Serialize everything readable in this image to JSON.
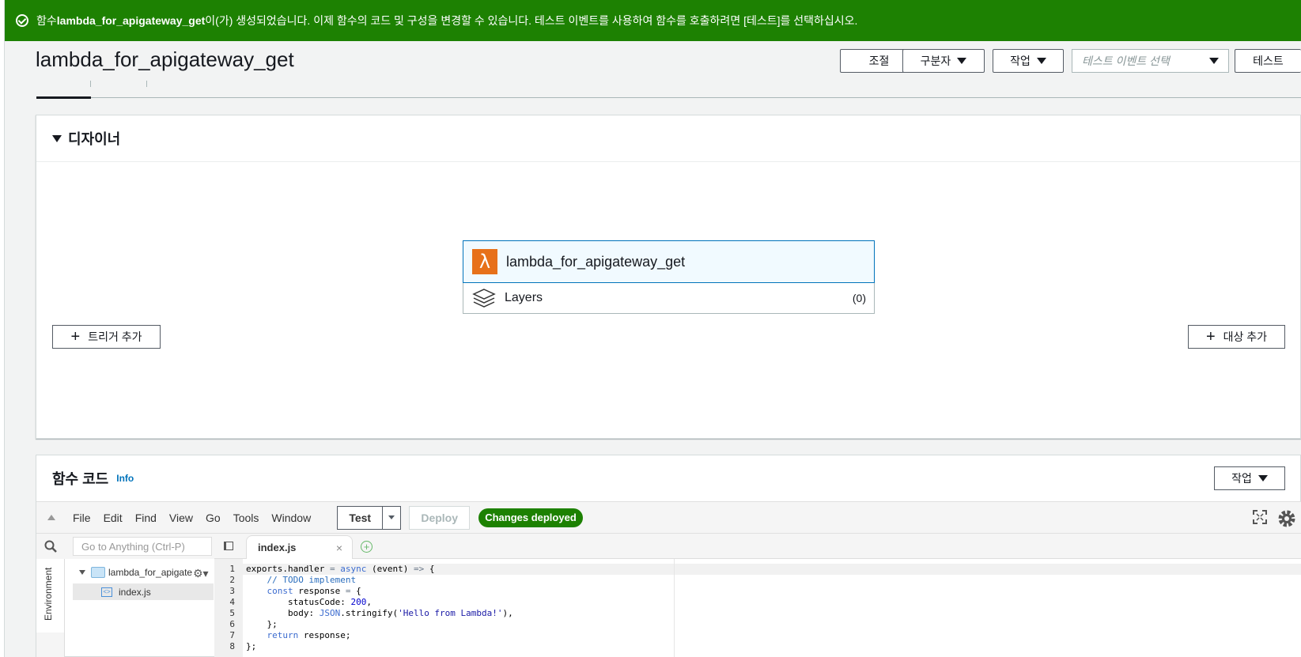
{
  "flash": {
    "prefix": "함수 ",
    "function_name": "lambda_for_apigateway_get",
    "message": "이(가) 생성되었습니다. 이제 함수의 코드 및 구성을 변경할 수 있습니다. 테스트 이벤트를 사용하여 함수를 호출하려면 [테스트]를 선택하십시오."
  },
  "header": {
    "title": "lambda_for_apigateway_get",
    "throttle_label": "조절",
    "qualifiers_label": "구분자",
    "actions_label": "작업",
    "test_event_placeholder": "테스트 이벤트 선택",
    "test_label": "테스트"
  },
  "designer": {
    "title": "디자이너",
    "function_name": "lambda_for_apigateway_get",
    "layers_label": "Layers",
    "layers_count": "(0)",
    "add_trigger_label": "트리거 추가",
    "add_destination_label": "대상 추가"
  },
  "code": {
    "title": "함수 코드",
    "info_label": "Info",
    "actions_label": "작업",
    "menu": [
      "File",
      "Edit",
      "Find",
      "View",
      "Go",
      "Tools",
      "Window"
    ],
    "test_label": "Test",
    "deploy_label": "Deploy",
    "status_badge": "Changes deployed",
    "goto_placeholder": "Go to Anything (Ctrl-P)",
    "environment_label": "Environment",
    "folder_name": "lambda_for_apigate",
    "file_name": "index.js",
    "tab_name": "index.js",
    "line_numbers": [
      "1",
      "2",
      "3",
      "4",
      "5",
      "6",
      "7",
      "8"
    ]
  },
  "colors": {
    "success_green": "#1d8102",
    "link_blue": "#0073bb",
    "lambda_orange": "#e7711a"
  }
}
